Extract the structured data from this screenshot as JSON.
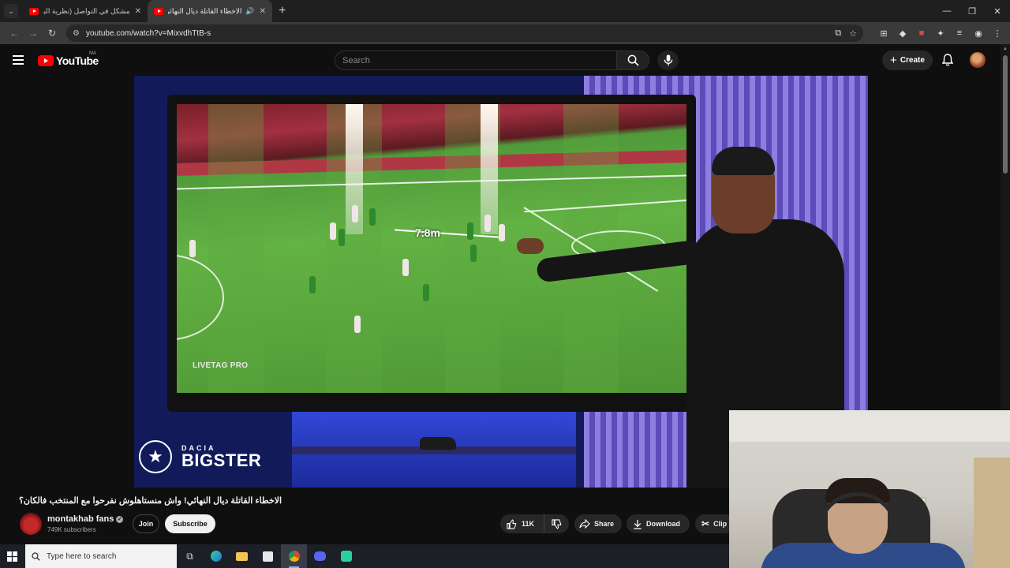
{
  "browser": {
    "tabs": [
      {
        "title": "مشكل في التواصل (نظرية البراك...",
        "active": false
      },
      {
        "title": "الاخطاء القاتلة ديال النهائي! و...",
        "active": true
      }
    ],
    "url": "youtube.com/watch?v=MixvdhTtB-s"
  },
  "youtube": {
    "logo_text": "YouTube",
    "country_code": "MA",
    "search_placeholder": "Search",
    "create_label": "Create"
  },
  "video": {
    "distance_label": "7.8m",
    "watermark": "LIVETAG PRO",
    "sponsor_top": "DACIA",
    "sponsor_main": "BIGSTER",
    "title": "الاخطاء القاتلة ديال النهائي! واش منستاهلوش نفرحوا مع المنتخب فالكان؟",
    "channel": {
      "name": "montakhab fans",
      "subscribers": "749K subscribers"
    },
    "join_label": "Join",
    "subscribe_label": "Subscribe",
    "like_count": "11K",
    "share_label": "Share",
    "download_label": "Download",
    "clip_label": "Clip"
  },
  "taskbar": {
    "search_placeholder": "Type here to search"
  },
  "colors": {
    "youtube_red": "#ff0000",
    "background": "#0f0f0f",
    "pill": "#272727"
  }
}
